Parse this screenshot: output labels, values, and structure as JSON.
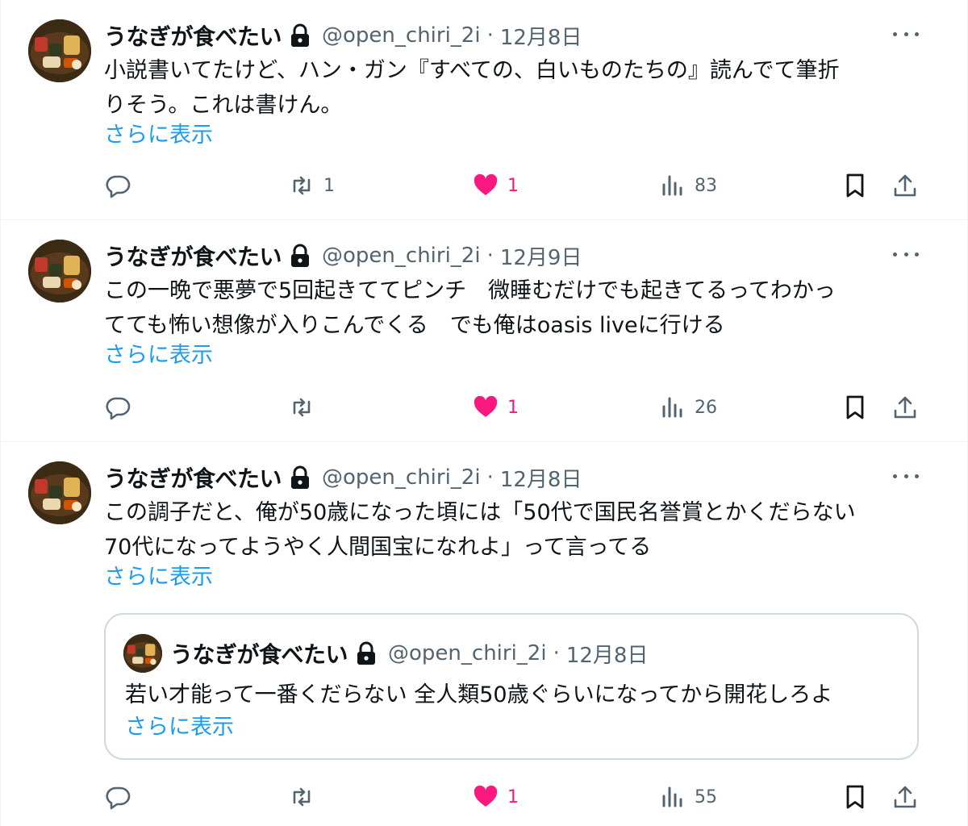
{
  "icons": {
    "avatar": "food-plate-avatar",
    "protected": "lock-icon",
    "more": "more-icon",
    "reply": "reply-icon",
    "retweet": "retweet-icon",
    "like": "heart-icon",
    "views": "views-icon",
    "bookmark": "bookmark-icon",
    "share": "share-icon"
  },
  "colors": {
    "link": "#1d9bf0",
    "like": "#f91880",
    "muted": "#536471",
    "text": "#0f1419",
    "border": "#cfd9de"
  },
  "tweets": [
    {
      "name": "うなぎが食べたい",
      "handle": "@open_chiri_2i",
      "dot": "·",
      "date": "12月8日",
      "text": "小説書いてたけど、ハン・ガン『すべての、白いものたちの』読んでて筆折\nりそう。これは書けん。",
      "show_more": "さらに表示",
      "retweets": "1",
      "likes": "1",
      "liked": true,
      "views": "83"
    },
    {
      "name": "うなぎが食べたい",
      "handle": "@open_chiri_2i",
      "dot": "·",
      "date": "12月9日",
      "text": "この一晩で悪夢で5回起きててピンチ　微睡むだけでも起きてるってわかっ\nてても怖い想像が入りこんでくる　でも俺はoasis liveに行ける",
      "show_more": "さらに表示",
      "retweets": "",
      "likes": "1",
      "liked": true,
      "views": "26"
    },
    {
      "name": "うなぎが食べたい",
      "handle": "@open_chiri_2i",
      "dot": "·",
      "date": "12月8日",
      "text": "この調子だと、俺が50歳になった頃には「50代で国民名誉賞とかくだらない\n70代になってようやく人間国宝になれよ」って言ってる",
      "show_more": "さらに表示",
      "retweets": "",
      "likes": "1",
      "liked": true,
      "views": "55",
      "quote": {
        "name": "うなぎが食べたい",
        "handle": "@open_chiri_2i",
        "dot": "·",
        "date": "12月8日",
        "text": "若い才能って一番くだらない 全人類50歳ぐらいになってから開花しろよ",
        "show_more": "さらに表示"
      }
    }
  ]
}
